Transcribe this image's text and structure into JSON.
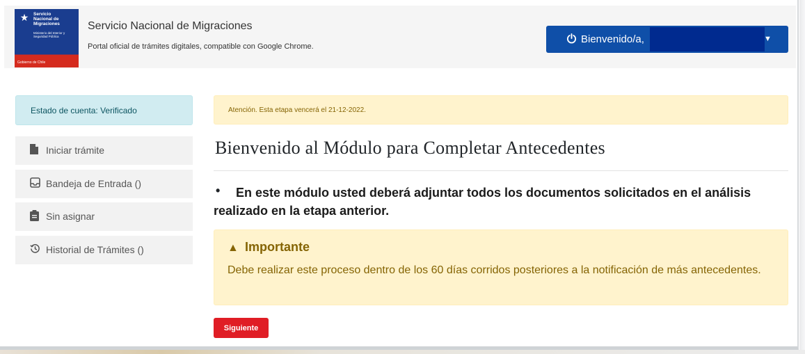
{
  "header": {
    "logo": {
      "name_lines": [
        "Servicio",
        "Nacional de",
        "Migraciones"
      ],
      "ministry": "Ministerio del Interior y Seguridad Pública",
      "gobierno": "Gobierno de Chile"
    },
    "title": "Servicio Nacional de Migraciones",
    "subtitle": "Portal oficial de trámites digitales, compatible con Google Chrome.",
    "user_button": {
      "label": "Bienvenido/a,",
      "icon": "power-icon",
      "caret_icon": "caret-down-icon"
    }
  },
  "sidebar": {
    "status": "Estado de cuenta: Verificado",
    "items": [
      {
        "label": "Iniciar trámite",
        "icon": "file-icon"
      },
      {
        "label": "Bandeja de Entrada ()",
        "icon": "inbox-icon"
      },
      {
        "label": "Sin asignar",
        "icon": "clipboard-icon"
      },
      {
        "label": "Historial de Trámites ()",
        "icon": "history-icon"
      }
    ]
  },
  "main": {
    "alert_top": "Atención. Esta etapa vencerá el 21-12-2022.",
    "title": "Bienvenido al Módulo para Completar Antecedentes",
    "bullet": "En este módulo usted deberá adjuntar todos los documentos solicitados en el análisis realizado en la etapa anterior.",
    "important": {
      "icon": "warning-icon",
      "heading": "Importante",
      "body": "Debe realizar este proceso dentro de los 60 días corridos posteriores a la notificación de más antecedentes."
    },
    "next_button": "Siguiente"
  },
  "colors": {
    "primary": "#0f4fa8",
    "danger": "#e01d25",
    "info_bg": "#d1ecf1",
    "warning_bg": "#fff3cd",
    "warning_text": "#856404"
  }
}
